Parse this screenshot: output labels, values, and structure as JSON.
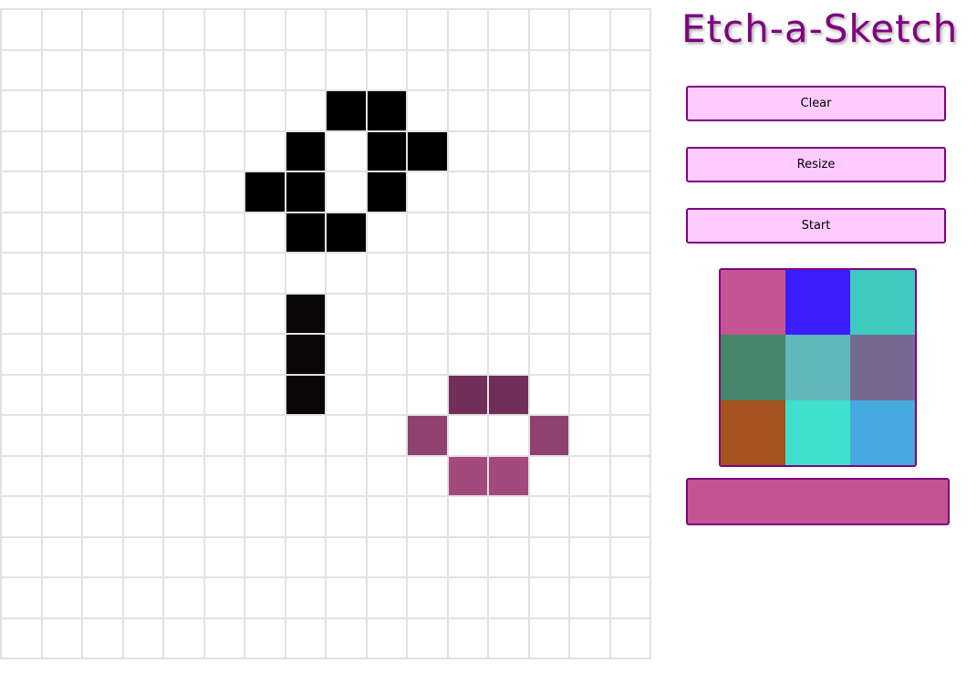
{
  "title": "Etch-a-Sketch",
  "buttons": {
    "clear": "Clear",
    "resize": "Resize",
    "start": "Start"
  },
  "grid": {
    "size": 16,
    "background": "#ffffff",
    "line_color": "#e2e2e2",
    "filled_cells": [
      {
        "row": 2,
        "col": 8,
        "color": "#000000"
      },
      {
        "row": 2,
        "col": 9,
        "color": "#000000"
      },
      {
        "row": 3,
        "col": 7,
        "color": "#000000"
      },
      {
        "row": 3,
        "col": 9,
        "color": "#000000"
      },
      {
        "row": 3,
        "col": 10,
        "color": "#000000"
      },
      {
        "row": 4,
        "col": 6,
        "color": "#000000"
      },
      {
        "row": 4,
        "col": 7,
        "color": "#000000"
      },
      {
        "row": 4,
        "col": 9,
        "color": "#000000"
      },
      {
        "row": 5,
        "col": 7,
        "color": "#000000"
      },
      {
        "row": 5,
        "col": 8,
        "color": "#000000"
      },
      {
        "row": 7,
        "col": 7,
        "color": "#0a0507"
      },
      {
        "row": 8,
        "col": 7,
        "color": "#0a0507"
      },
      {
        "row": 9,
        "col": 7,
        "color": "#0a0507"
      },
      {
        "row": 9,
        "col": 11,
        "color": "#6f2f59"
      },
      {
        "row": 9,
        "col": 12,
        "color": "#6f2f59"
      },
      {
        "row": 10,
        "col": 10,
        "color": "#8f416f"
      },
      {
        "row": 10,
        "col": 13,
        "color": "#8f416f"
      },
      {
        "row": 11,
        "col": 11,
        "color": "#a4497c"
      },
      {
        "row": 11,
        "col": 12,
        "color": "#a4497c"
      }
    ]
  },
  "palette": [
    {
      "name": "rose",
      "color": "#c45592"
    },
    {
      "name": "blue",
      "color": "#3b1eff"
    },
    {
      "name": "teal",
      "color": "#3ecbbd"
    },
    {
      "name": "green",
      "color": "#45866b"
    },
    {
      "name": "light-teal",
      "color": "#62b8b8"
    },
    {
      "name": "purple-grey",
      "color": "#766a93"
    },
    {
      "name": "rust",
      "color": "#a5531f"
    },
    {
      "name": "turquoise",
      "color": "#41e0cd"
    },
    {
      "name": "sky-blue",
      "color": "#46aade"
    }
  ],
  "current_color": "#c45592"
}
